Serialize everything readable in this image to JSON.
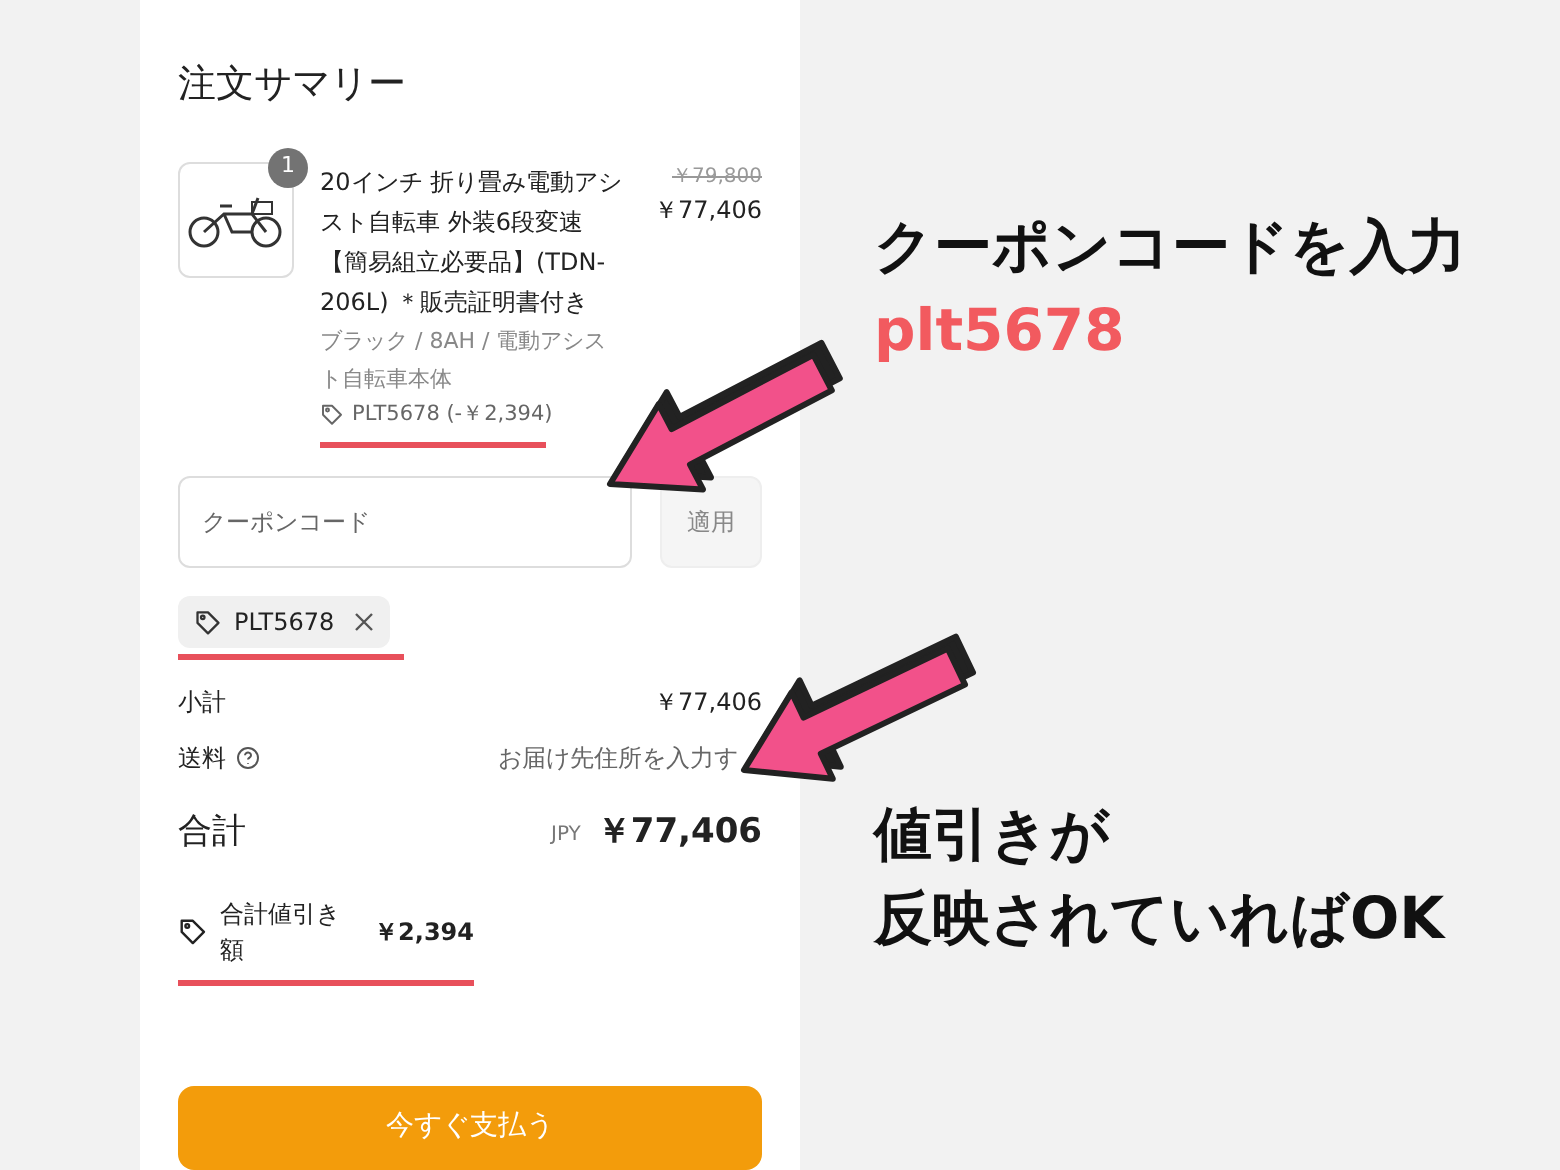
{
  "heading": "注文サマリー",
  "item": {
    "quantity": "1",
    "name": "20インチ 折り畳み電動アシスト自転車 外装6段変速【簡易組立必要品】(TDN-206L) ＊販売証明書付き",
    "variant": "ブラック / 8AH / 電動アシスト自転車本体",
    "discount": "PLT5678 (-￥2,394)",
    "original_price": "￥79,800",
    "price": "￥77,406"
  },
  "coupon": {
    "placeholder": "クーポンコード",
    "apply": "適用"
  },
  "applied_codes": [
    {
      "code": "PLT5678"
    }
  ],
  "summary": {
    "subtotal_label": "小計",
    "subtotal": "￥77,406",
    "shipping_label": "送料",
    "shipping": "お届け先住所を入力す",
    "total_label": "合計",
    "currency": "JPY",
    "total": "￥77,406",
    "discount_label": "合計値引き額",
    "discount": "￥2,394"
  },
  "pay_button": "今すぐ支払う",
  "annotations": [
    {
      "lines": [
        {
          "text": "クーポンコードを入力",
          "color": "#111111"
        },
        {
          "text": "plt5678",
          "color": "#f25a5f"
        }
      ]
    },
    {
      "lines": [
        {
          "text": "値引きが",
          "color": "#111111"
        },
        {
          "text": "反映されていればOK",
          "color": "#111111"
        }
      ]
    }
  ]
}
